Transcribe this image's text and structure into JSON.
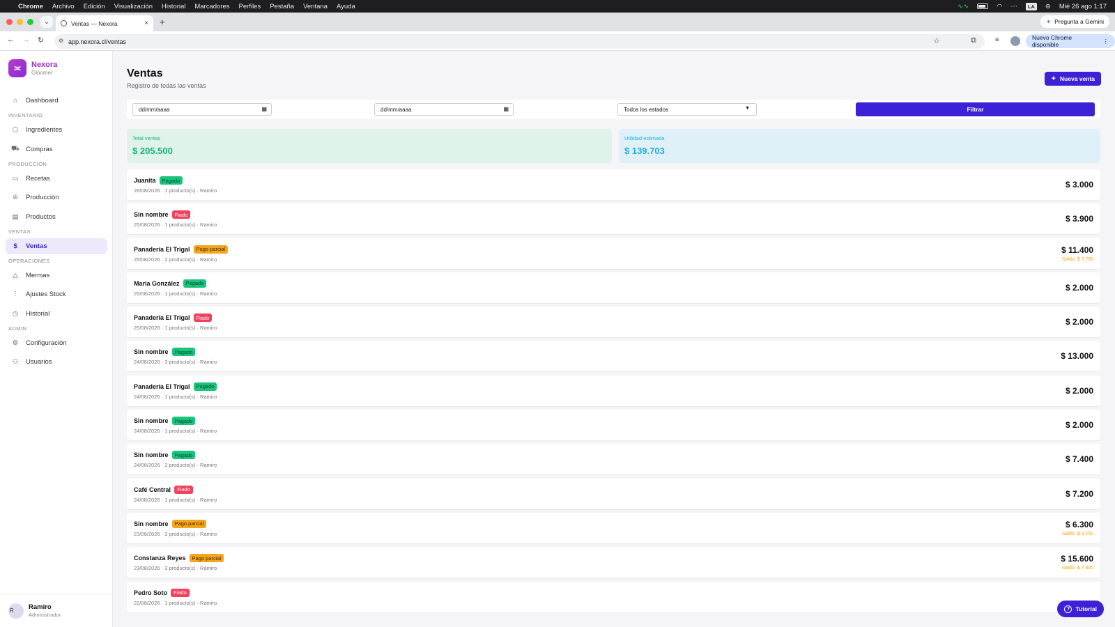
{
  "menubar": {
    "app": "Chrome",
    "items": [
      "Archivo",
      "Edición",
      "Visualización",
      "Historial",
      "Marcadores",
      "Perfiles",
      "Pestaña",
      "Ventana",
      "Ayuda"
    ],
    "input_source": "LA",
    "datetime": "Mié 26 ago 1:17"
  },
  "browser": {
    "tab_title": "Ventas — Nexora",
    "url": "app.nexora.cl/ventas",
    "gemini_label": "Pregunta a Gemini",
    "update_label": "Nuevo Chrome disponible"
  },
  "brand": {
    "name": "Nexora",
    "subtitle": "Gloomer"
  },
  "nav": {
    "dashboard": "Dashboard",
    "section_inventario": "INVENTARIO",
    "ingredientes": "Ingredientes",
    "compras": "Compras",
    "section_produccion": "PRODUCCIÓN",
    "recetas": "Recetas",
    "produccion": "Producción",
    "productos": "Productos",
    "section_ventas": "VENTAS",
    "ventas": "Ventas",
    "section_operaciones": "OPERACIONES",
    "mermas": "Mermas",
    "ajustes": "Ajustes Stock",
    "historial": "Historial",
    "section_admin": "ADMIN",
    "configuracion": "Configuración",
    "usuarios": "Usuarios"
  },
  "user": {
    "initial": "R",
    "name": "Ramiro",
    "role": "Administrador"
  },
  "page": {
    "title": "Ventas",
    "subtitle": "Registro de todas las ventas",
    "new_button": "Nueva venta"
  },
  "filters": {
    "date_from": "dd/mm/aaaa",
    "date_to": "dd/mm/aaaa",
    "status": "Todos los estados",
    "button": "Filtrar"
  },
  "summary": {
    "total_label": "Total ventas",
    "total_value": "$ 205.500",
    "util_label": "Utilidad estimada",
    "util_value": "$ 139.703"
  },
  "sales": [
    {
      "name": "Juanita",
      "status": "Pagado",
      "meta": "26/08/2026 · 1 producto(s) · Ramiro",
      "amount": "$ 3.000"
    },
    {
      "name": "Sin nombre",
      "status": "Fiado",
      "meta": "25/08/2026 · 1 producto(s) · Ramiro",
      "amount": "$ 3.900"
    },
    {
      "name": "Panadería El Trigal",
      "status": "Pago parcial",
      "meta": "25/08/2026 · 2 producto(s) · Ramiro",
      "amount": "$ 11.400",
      "saldo": "Saldo: $ 5.700"
    },
    {
      "name": "María González",
      "status": "Pagado",
      "meta": "25/08/2026 · 1 producto(s) · Ramiro",
      "amount": "$ 2.000"
    },
    {
      "name": "Panadería El Trigal",
      "status": "Fiado",
      "meta": "25/08/2026 · 1 producto(s) · Ramiro",
      "amount": "$ 2.000"
    },
    {
      "name": "Sin nombre",
      "status": "Pagado",
      "meta": "24/08/2026 · 3 producto(s) · Ramiro",
      "amount": "$ 13.000"
    },
    {
      "name": "Panadería El Trigal",
      "status": "Pagado",
      "meta": "24/08/2026 · 1 producto(s) · Ramiro",
      "amount": "$ 2.000"
    },
    {
      "name": "Sin nombre",
      "status": "Pagado",
      "meta": "24/08/2026 · 1 producto(s) · Ramiro",
      "amount": "$ 2.000"
    },
    {
      "name": "Sin nombre",
      "status": "Pagado",
      "meta": "24/08/2026 · 2 producto(s) · Ramiro",
      "amount": "$ 7.400"
    },
    {
      "name": "Café Central",
      "status": "Fiado",
      "meta": "24/08/2026 · 1 producto(s) · Ramiro",
      "amount": "$ 7.200"
    },
    {
      "name": "Sin nombre",
      "status": "Pago parcial",
      "meta": "23/08/2026 · 2 producto(s) · Ramiro",
      "amount": "$ 6.300",
      "saldo": "Saldo: $ 3.150"
    },
    {
      "name": "Constanza Reyes",
      "status": "Pago parcial",
      "meta": "23/08/2026 · 3 producto(s) · Ramiro",
      "amount": "$ 15.600",
      "saldo": "Saldo: $ 7.800"
    },
    {
      "name": "Pedro Soto",
      "status": "Fiado",
      "meta": "22/08/2026 · 1 producto(s) · Ramiro",
      "amount": ""
    }
  ],
  "tutorial_label": "Tutorial",
  "colors": {
    "primary": "#3b22d6",
    "brand": "#9d2cc8",
    "pagado": "#18c47e",
    "fiado": "#f2415d",
    "parcial": "#f3a51b"
  }
}
